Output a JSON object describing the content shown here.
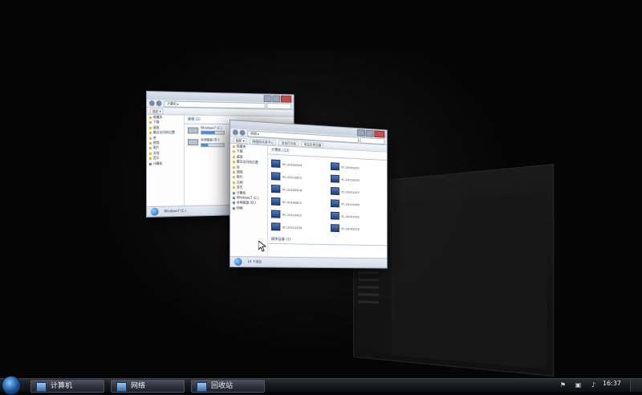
{
  "taskbar": {
    "buttons": [
      {
        "label": "计算机",
        "icon": "computer-icon"
      },
      {
        "label": "网络",
        "icon": "network-icon"
      },
      {
        "label": "回收站",
        "icon": "recycle-bin-icon"
      }
    ],
    "tray_icons": [
      "flag-icon",
      "network-tray-icon",
      "volume-icon"
    ],
    "clock": "16:37"
  },
  "back_window": {
    "title": "计算机",
    "address": "计算机 ▸",
    "sidebar": [
      "收藏夹",
      "下载",
      "桌面",
      "最近访问的位置",
      "库",
      "视频",
      "图片",
      "文档",
      "音乐",
      "计算机"
    ],
    "group_title": "硬盘 (2)",
    "drives": [
      {
        "name": "Windows7 (C:)",
        "fill": 0.6
      },
      {
        "name": "本地磁盘 (D:)",
        "fill": 0.3
      }
    ],
    "status": "Windows7 (C:)"
  },
  "front_window": {
    "title": "网络",
    "address": "网络 ▸",
    "toolbar": [
      "组织 ▾",
      "网络和共享中心",
      "添加打印机",
      "添加无线设备"
    ],
    "sidebar": [
      "收藏夹",
      "下载",
      "桌面",
      "最近访问的位置",
      "库",
      "视频",
      "图片",
      "文档",
      "音乐",
      "计算机",
      "Windows7 (C:)",
      "本地磁盘 (D:)",
      "网络"
    ],
    "group_title": "计算机 (12)",
    "computers": [
      "PC-20100504",
      "PC-20100101",
      "PC-20110612",
      "PC-20110203",
      "PC-20100918",
      "PC-20101207",
      "PC-20100812",
      "PC-20110305",
      "PC-20110421",
      "PC-20101022",
      "PC-20101130",
      "PC-20100715"
    ],
    "group2_title": "媒体设备 (1)",
    "status": "14 个项目"
  }
}
